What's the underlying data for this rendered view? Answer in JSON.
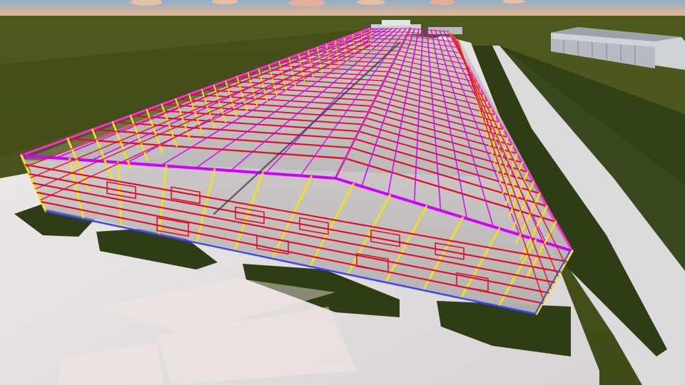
{
  "scene": {
    "colors": {
      "sky_top": "#8fb0c8",
      "sky_glow": "#f2b58f",
      "field_far": "#4d5720",
      "field_near": "#5a6124",
      "grass": "#2f3d16",
      "slab": "#e8e6e6",
      "slab_shadow": "#c9c4c4",
      "floor": "#bdb8b8",
      "rafter": "#c8003e",
      "purlin": "#d000ff",
      "column_yellow": "#f0e020",
      "girt_red": "#e0102a",
      "base_blue": "#3b46ff",
      "ridge_magenta": "#ff2bd6"
    },
    "objects": [
      {
        "name": "steel-frame-warehouse"
      },
      {
        "name": "concrete-slab"
      },
      {
        "name": "distant-hangar-building"
      },
      {
        "name": "distant-office-building"
      }
    ]
  }
}
